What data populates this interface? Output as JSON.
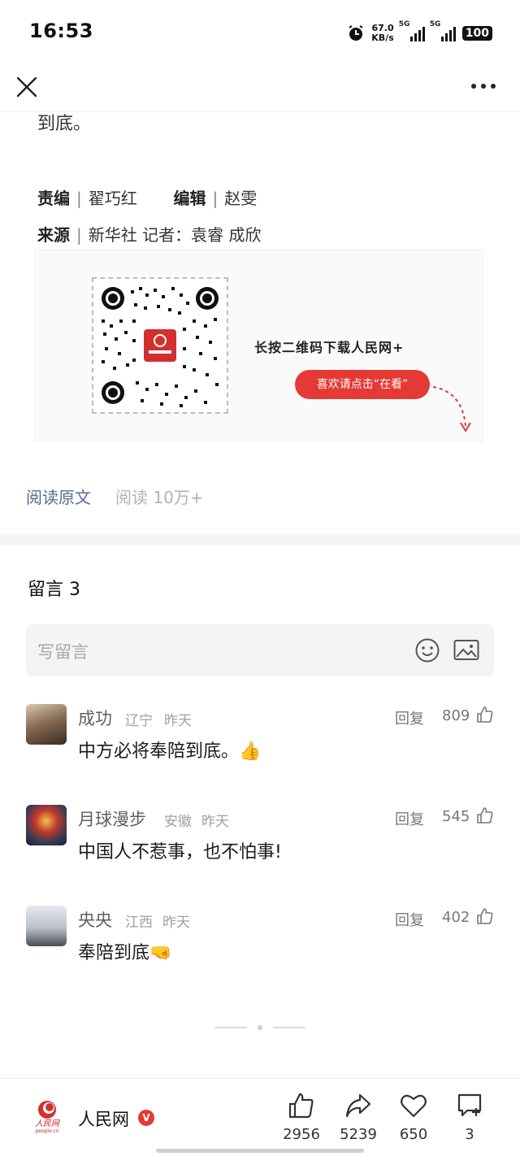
{
  "status_bar": {
    "time": "16:53",
    "net_speed_value": "67.0",
    "net_speed_unit": "KB/s",
    "signal_1_label": "5G",
    "signal_2_label": "5G",
    "battery": "100",
    "icons": [
      "alarm-icon",
      "signal-icon",
      "battery-icon"
    ]
  },
  "nav": {
    "close_icon": "close-icon",
    "more_icon": "more-icon"
  },
  "article": {
    "ending_text": "到底。",
    "editor_label": "责编",
    "editor_name": "翟巧红",
    "editor2_label": "编辑",
    "editor2_name": "赵雯",
    "source_label": "来源",
    "source_value": "新华社 记者：袁睿 成欣",
    "qr_prompt": "长按二维码下载人民网+",
    "like_prompt": "喜欢请点击“在看”",
    "read_original": "阅读原文",
    "read_count": "阅读 10万+"
  },
  "comments": {
    "title": "留言 3",
    "input_placeholder": "写留言",
    "input_icons": [
      "emoji-icon",
      "image-icon"
    ],
    "items": [
      {
        "author": "成功",
        "region": "辽宁",
        "time": "昨天",
        "text": "中方必将奉陪到底。👍",
        "reply": "回复",
        "likes": "809",
        "avatar_color": "#6b5a4a"
      },
      {
        "author": "月球漫步",
        "region": "安徽",
        "time": "昨天",
        "text": "中国人不惹事，也不怕事!",
        "reply": "回复",
        "likes": "545",
        "avatar_color": "#2f3a56"
      },
      {
        "author": "央央",
        "region": "江西",
        "time": "昨天",
        "text": "奉陪到底🤜",
        "reply": "回复",
        "likes": "402",
        "avatar_color": "#9aa3ad"
      }
    ]
  },
  "bottom_bar": {
    "brand_name": "人民网",
    "brand_logo_text": "人民网",
    "brand_logo_sub": "people.cn",
    "verified_badge": "V",
    "like_count": "2956",
    "share_count": "5239",
    "wow_count": "650",
    "comment_count": "3"
  },
  "colors": {
    "accent_red": "#e53935",
    "link_blue": "#576b95"
  }
}
